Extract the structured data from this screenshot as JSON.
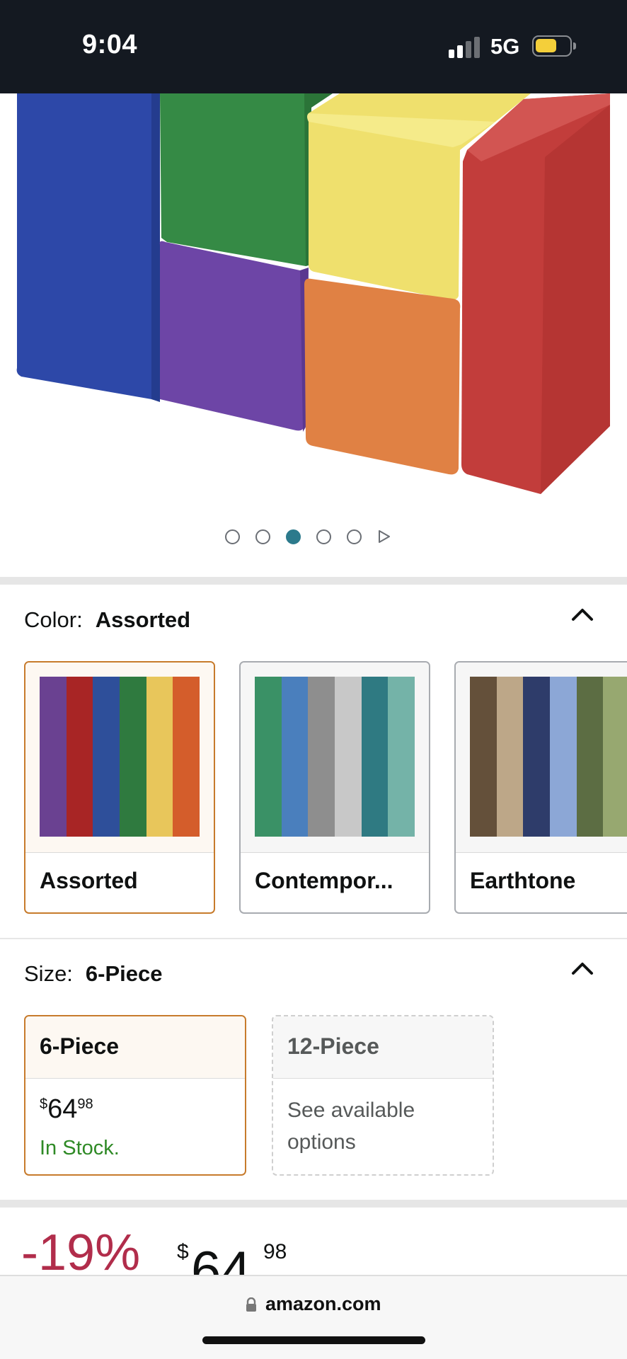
{
  "status_bar": {
    "time": "9:04",
    "network": "5G",
    "battery_color": "#f4cf3a",
    "signal_bars_active": 2
  },
  "image_carousel": {
    "dot_count": 5,
    "active_index": 2,
    "has_video_indicator": true,
    "active_dot_color": "#2c7a8c"
  },
  "color_selector": {
    "label": "Color:",
    "selected_value": "Assorted",
    "options": [
      {
        "name": "Assorted",
        "selected": true,
        "stripes": [
          "#6a4191",
          "#a82525",
          "#2e4f9a",
          "#2f7a3f",
          "#e8c65b",
          "#d45d2b"
        ]
      },
      {
        "name": "Contempor...",
        "selected": false,
        "stripes": [
          "#3a9166",
          "#4a7fbd",
          "#8e8e8e",
          "#c8c8c8",
          "#2f7a82",
          "#74b3a8"
        ]
      },
      {
        "name": "Earthtone",
        "selected": false,
        "stripes": [
          "#64503a",
          "#bda788",
          "#2e3c6a",
          "#8ca7d6",
          "#5c6d43",
          "#97a870"
        ]
      }
    ]
  },
  "size_selector": {
    "label": "Size:",
    "selected_value": "6-Piece",
    "options": [
      {
        "name": "6-Piece",
        "price_symbol": "$",
        "price_whole": "64",
        "price_fraction": "98",
        "stock": "In Stock."
      },
      {
        "name": "12-Piece",
        "note": "See available options"
      }
    ]
  },
  "price": {
    "discount": "-19%",
    "currency": "$",
    "whole": "64",
    "fraction": "98"
  },
  "browser": {
    "url": "amazon.com"
  }
}
